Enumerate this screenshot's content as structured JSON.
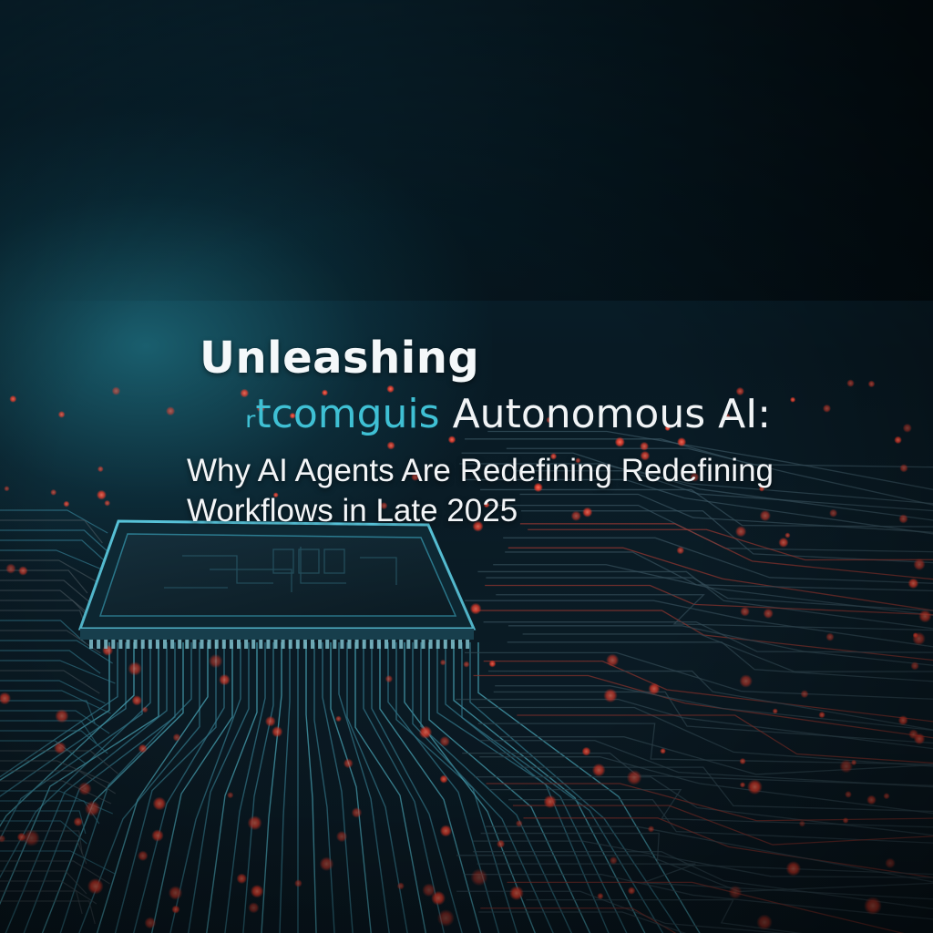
{
  "image": {
    "headline": {
      "line1": "Unleashing",
      "line2_accent": "ᵣtcomguis",
      "line2_main": "Autonomous AI:",
      "subtitle_line1": "Why AI Agents Are Redefining Redefining",
      "subtitle_line2": "Workflows in Late 2025"
    },
    "colors": {
      "accent_teal": "#3fc0d4",
      "circuit_red": "#ff4a3a",
      "circuit_cyan": "#58c8de",
      "background": "#0a1c26"
    },
    "icons": {
      "chip": "microchip-icon"
    }
  }
}
